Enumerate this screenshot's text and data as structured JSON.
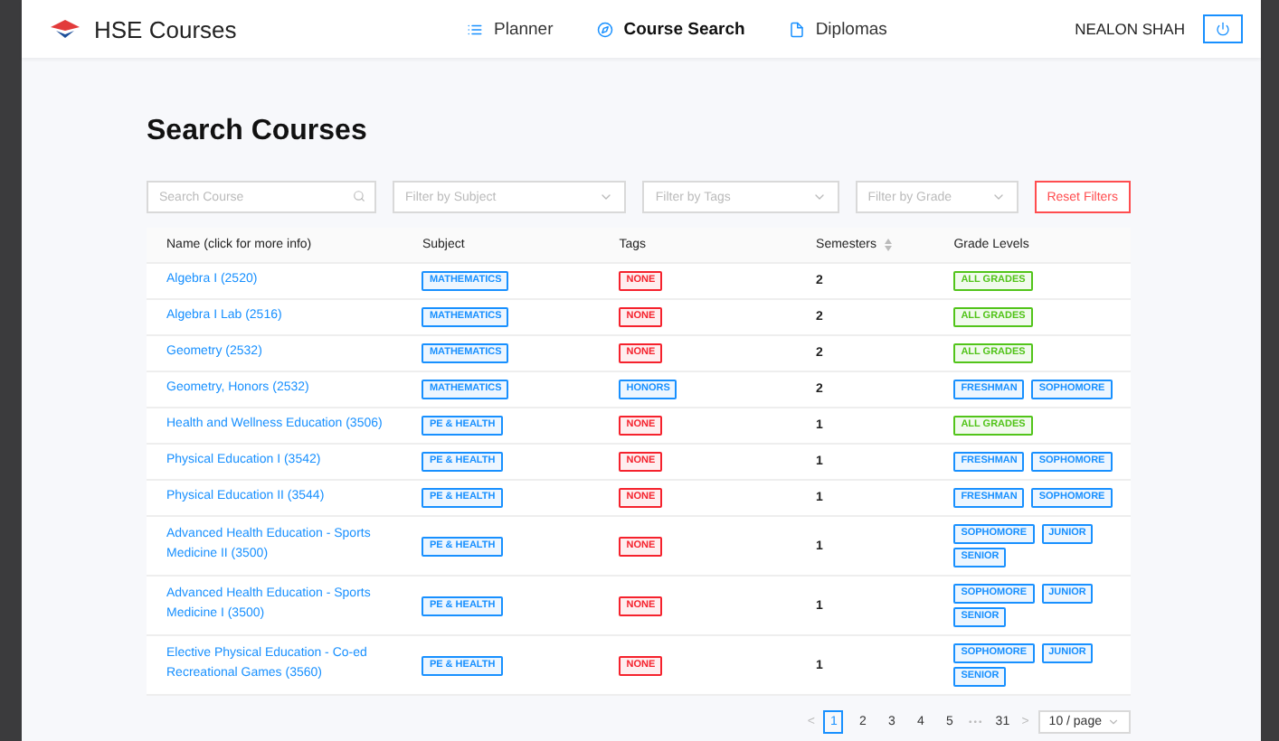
{
  "app": {
    "name": "HSE Courses"
  },
  "nav": [
    {
      "label": "Planner",
      "selected": false
    },
    {
      "label": "Course Search",
      "selected": true
    },
    {
      "label": "Diplomas",
      "selected": false
    }
  ],
  "user": {
    "name": "NEALON SHAH"
  },
  "page_title": "Search Courses",
  "filters": {
    "search_placeholder": "Search Course",
    "selects": [
      {
        "placeholder": "Filter by Subject"
      },
      {
        "placeholder": "Filter by Tags"
      },
      {
        "placeholder": "Filter by Grade"
      }
    ],
    "reset": "Reset Filters"
  },
  "table": {
    "columns": [
      {
        "label": "Name (click for more info)",
        "sortable": false
      },
      {
        "label": "Subject",
        "sortable": false
      },
      {
        "label": "Tags",
        "sortable": false
      },
      {
        "label": "Semesters",
        "sortable": true
      },
      {
        "label": "Grade Levels",
        "sortable": false
      }
    ],
    "rows": [
      {
        "name": "Algebra I (2520)",
        "subject": {
          "label": "MATHEMATICS",
          "color": "#1890ff"
        },
        "tags": [
          {
            "label": "NONE",
            "color": "#f5222d"
          }
        ],
        "semesters": "2",
        "grades": [
          {
            "label": "ALL GRADES",
            "color": "#52c41a"
          }
        ]
      },
      {
        "name": "Algebra I Lab (2516)",
        "subject": {
          "label": "MATHEMATICS",
          "color": "#1890ff"
        },
        "tags": [
          {
            "label": "NONE",
            "color": "#f5222d"
          }
        ],
        "semesters": "2",
        "grades": [
          {
            "label": "ALL GRADES",
            "color": "#52c41a"
          }
        ]
      },
      {
        "name": "Geometry (2532)",
        "subject": {
          "label": "MATHEMATICS",
          "color": "#1890ff"
        },
        "tags": [
          {
            "label": "NONE",
            "color": "#f5222d"
          }
        ],
        "semesters": "2",
        "grades": [
          {
            "label": "ALL GRADES",
            "color": "#52c41a"
          }
        ]
      },
      {
        "name": "Geometry, Honors (2532)",
        "subject": {
          "label": "MATHEMATICS",
          "color": "#1890ff"
        },
        "tags": [
          {
            "label": "HONORS",
            "color": "#1890ff"
          }
        ],
        "semesters": "2",
        "grades": [
          {
            "label": "FRESHMAN",
            "color": "#1890ff"
          },
          {
            "label": "SOPHOMORE",
            "color": "#1890ff"
          }
        ]
      },
      {
        "name": "Health and Wellness Education (3506)",
        "subject": {
          "label": "PE & HEALTH",
          "color": "#1890ff"
        },
        "tags": [
          {
            "label": "NONE",
            "color": "#f5222d"
          }
        ],
        "semesters": "1",
        "grades": [
          {
            "label": "ALL GRADES",
            "color": "#52c41a"
          }
        ]
      },
      {
        "name": "Physical Education I (3542)",
        "subject": {
          "label": "PE & HEALTH",
          "color": "#1890ff"
        },
        "tags": [
          {
            "label": "NONE",
            "color": "#f5222d"
          }
        ],
        "semesters": "1",
        "grades": [
          {
            "label": "FRESHMAN",
            "color": "#1890ff"
          },
          {
            "label": "SOPHOMORE",
            "color": "#1890ff"
          }
        ]
      },
      {
        "name": "Physical Education II (3544)",
        "subject": {
          "label": "PE & HEALTH",
          "color": "#1890ff"
        },
        "tags": [
          {
            "label": "NONE",
            "color": "#f5222d"
          }
        ],
        "semesters": "1",
        "grades": [
          {
            "label": "FRESHMAN",
            "color": "#1890ff"
          },
          {
            "label": "SOPHOMORE",
            "color": "#1890ff"
          }
        ]
      },
      {
        "name": "Advanced Health Education - Sports Medicine II (3500)",
        "subject": {
          "label": "PE & HEALTH",
          "color": "#1890ff"
        },
        "tags": [
          {
            "label": "NONE",
            "color": "#f5222d"
          }
        ],
        "semesters": "1",
        "grades": [
          {
            "label": "SOPHOMORE",
            "color": "#1890ff"
          },
          {
            "label": "JUNIOR",
            "color": "#1890ff"
          },
          {
            "label": "SENIOR",
            "color": "#1890ff"
          }
        ]
      },
      {
        "name": "Advanced Health Education - Sports Medicine I (3500)",
        "subject": {
          "label": "PE & HEALTH",
          "color": "#1890ff"
        },
        "tags": [
          {
            "label": "NONE",
            "color": "#f5222d"
          }
        ],
        "semesters": "1",
        "grades": [
          {
            "label": "SOPHOMORE",
            "color": "#1890ff"
          },
          {
            "label": "JUNIOR",
            "color": "#1890ff"
          },
          {
            "label": "SENIOR",
            "color": "#1890ff"
          }
        ]
      },
      {
        "name": "Elective Physical Education - Co-ed Recreational Games (3560)",
        "subject": {
          "label": "PE & HEALTH",
          "color": "#1890ff"
        },
        "tags": [
          {
            "label": "NONE",
            "color": "#f5222d"
          }
        ],
        "semesters": "1",
        "grades": [
          {
            "label": "SOPHOMORE",
            "color": "#1890ff"
          },
          {
            "label": "JUNIOR",
            "color": "#1890ff"
          },
          {
            "label": "SENIOR",
            "color": "#1890ff"
          }
        ]
      }
    ]
  },
  "pagination": {
    "prev": "<",
    "pages": [
      {
        "label": "1",
        "selected": true
      },
      {
        "label": "2",
        "selected": false
      },
      {
        "label": "3",
        "selected": false
      },
      {
        "label": "4",
        "selected": false
      },
      {
        "label": "5",
        "selected": false
      }
    ],
    "ellipsis": "•••",
    "last": "31",
    "next": ">",
    "page_size": "10 / page"
  }
}
